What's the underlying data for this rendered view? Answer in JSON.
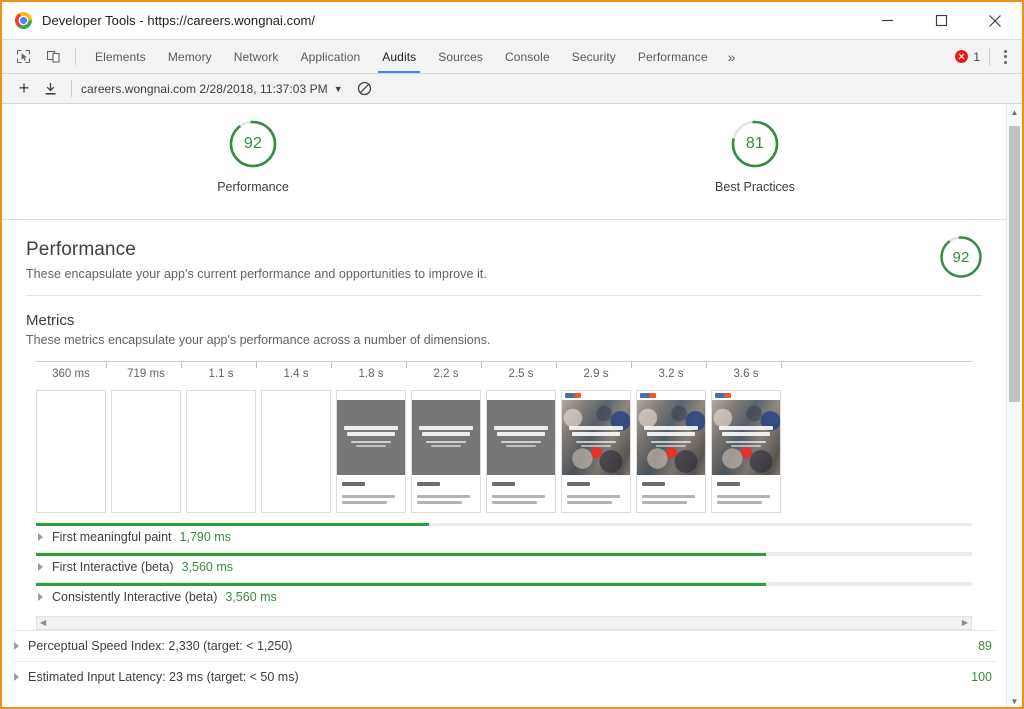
{
  "window": {
    "title": "Developer Tools - https://careers.wongnai.com/",
    "logo_icon": "chrome-logo-icon",
    "controls": {
      "minimize": "minimize-icon",
      "maximize": "maximize-icon",
      "close": "close-icon"
    }
  },
  "tabstrip": {
    "left_icons": [
      {
        "name": "inspect-element-icon"
      },
      {
        "name": "device-toolbar-icon"
      }
    ],
    "tabs": [
      {
        "label": "Elements",
        "active": false
      },
      {
        "label": "Memory",
        "active": false
      },
      {
        "label": "Network",
        "active": false
      },
      {
        "label": "Application",
        "active": false
      },
      {
        "label": "Audits",
        "active": true
      },
      {
        "label": "Sources",
        "active": false
      },
      {
        "label": "Console",
        "active": false
      },
      {
        "label": "Security",
        "active": false
      },
      {
        "label": "Performance",
        "active": false
      }
    ],
    "more_label": "»",
    "error_count": "1",
    "error_icon": "error-circle-icon",
    "menu_icon": "kebab-menu-icon"
  },
  "actionbar": {
    "add_icon": "plus-icon",
    "import_icon": "download-import-icon",
    "report_label": "careers.wongnai.com 2/28/2018, 11:37:03 PM",
    "report_caret": "▼",
    "clear_icon": "no-entry-clear-icon"
  },
  "scores": [
    {
      "value": "92",
      "label": "Performance",
      "percent": 92,
      "color": "#3a8a46"
    },
    {
      "value": "81",
      "label": "Best Practices",
      "percent": 81,
      "color": "#3a8a46"
    }
  ],
  "category": {
    "title": "Performance",
    "description": "These encapsulate your app's current performance and opportunities to improve it.",
    "score": "92",
    "score_percent": 92
  },
  "metrics_section": {
    "title": "Metrics",
    "description": "These metrics encapsulate your app's performance across a number of dimensions."
  },
  "filmstrip": {
    "ticks": [
      "360 ms",
      "719 ms",
      "1.1 s",
      "1.4 s",
      "1.8 s",
      "2.2 s",
      "2.5 s",
      "2.9 s",
      "3.2 s",
      "3.6 s"
    ],
    "frames": [
      {
        "state": "blank"
      },
      {
        "state": "blank"
      },
      {
        "state": "blank"
      },
      {
        "state": "blank"
      },
      {
        "state": "gray"
      },
      {
        "state": "gray"
      },
      {
        "state": "gray"
      },
      {
        "state": "photo"
      },
      {
        "state": "photo"
      },
      {
        "state": "photo"
      }
    ]
  },
  "metric_bars": [
    {
      "name": "First meaningful paint",
      "value": "1,790 ms",
      "percent": 42
    },
    {
      "name": "First Interactive (beta)",
      "value": "3,560 ms",
      "percent": 78
    },
    {
      "name": "Consistently Interactive (beta)",
      "value": "3,560 ms",
      "percent": 78
    }
  ],
  "hscrollbar": {
    "left_arrow": "◀",
    "right_arrow": "▶"
  },
  "audit_rows": [
    {
      "label": "Perceptual Speed Index: 2,330 (target: < 1,250)",
      "score": "89"
    },
    {
      "label": "Estimated Input Latency: 23 ms (target: < 50 ms)",
      "score": "100"
    }
  ],
  "vscrollbar": {
    "up_arrow": "▲",
    "down_arrow": "▼"
  }
}
